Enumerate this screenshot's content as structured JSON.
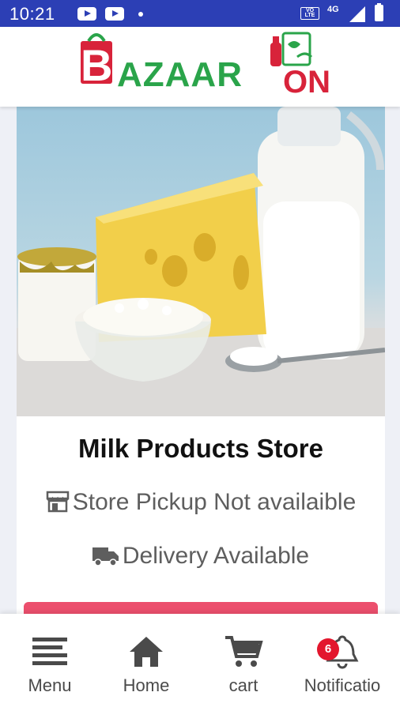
{
  "status_bar": {
    "time": "10:21",
    "network": "4G"
  },
  "header": {
    "logo_text": "BAZAAR ON",
    "logo_b": "B",
    "logo_mid": "AZAAR",
    "logo_on": "ON"
  },
  "store": {
    "name": "Milk Products Store",
    "pickup": "Store Pickup Not availaible",
    "delivery": "Delivery Available"
  },
  "bottom_nav": {
    "items": [
      {
        "label": "Menu",
        "icon": "menu-icon"
      },
      {
        "label": "Home",
        "icon": "home-icon"
      },
      {
        "label": "cart",
        "icon": "cart-icon"
      },
      {
        "label": "Notificatio",
        "icon": "bell-icon"
      }
    ],
    "notification_count": "6"
  },
  "colors": {
    "status_bar": "#2c3fb5",
    "brand_red": "#d8233a",
    "brand_green": "#2aa44a",
    "cta": "#ec4f6d",
    "badge": "#e3162d"
  }
}
